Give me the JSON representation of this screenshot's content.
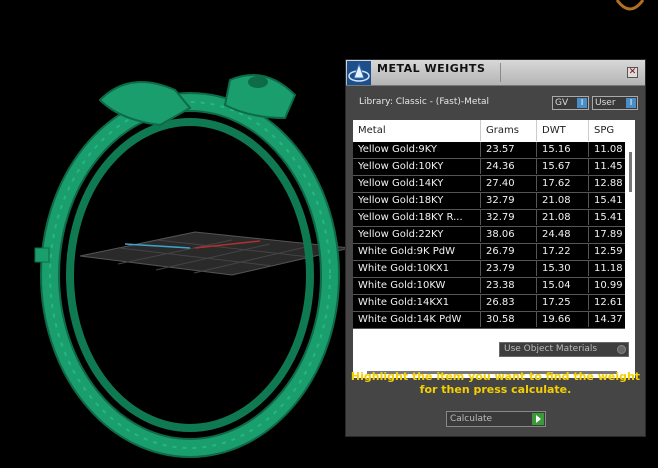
{
  "panel": {
    "title": "METAL WEIGHTS",
    "close_glyph": "✕",
    "library_label": "Library: Classic - (Fast)-Metal",
    "gv_label": "GV",
    "user_label": "User",
    "use_object_materials": "Use Object Materials",
    "hint_line1": "Highlight the item you want to find the weight",
    "hint_line2": "for then press calculate.",
    "calculate_label": "Calculate"
  },
  "table": {
    "columns": [
      "Metal",
      "Grams",
      "DWT",
      "SPG"
    ],
    "rows": [
      [
        "Yellow Gold:9KY",
        "23.57",
        "15.16",
        "11.08"
      ],
      [
        "Yellow Gold:10KY",
        "24.36",
        "15.67",
        "11.45"
      ],
      [
        "Yellow Gold:14KY",
        "27.40",
        "17.62",
        "12.88"
      ],
      [
        "Yellow Gold:18KY",
        "32.79",
        "21.08",
        "15.41"
      ],
      [
        "Yellow Gold:18KY R...",
        "32.79",
        "21.08",
        "15.41"
      ],
      [
        "Yellow Gold:22KY",
        "38.06",
        "24.48",
        "17.89"
      ],
      [
        "White Gold:9K PdW",
        "26.79",
        "17.22",
        "12.59"
      ],
      [
        "White Gold:10KX1",
        "23.79",
        "15.30",
        "11.18"
      ],
      [
        "White Gold:10KW",
        "23.38",
        "15.04",
        "10.99"
      ],
      [
        "White Gold:14KX1",
        "26.83",
        "17.25",
        "12.61"
      ],
      [
        "White Gold:14K PdW",
        "30.58",
        "19.66",
        "14.37"
      ]
    ]
  },
  "colors": {
    "ring": "#1a9e6e",
    "ring_dark": "#0d6b48",
    "hint": "#f5d000",
    "panel_bg": "#454545"
  },
  "icons": {
    "logo": "matrix-logo-icon",
    "close": "close-icon",
    "toggle_knob": "toggle-knob-icon",
    "radio": "radio-dot-icon",
    "calculate": "play-icon"
  }
}
